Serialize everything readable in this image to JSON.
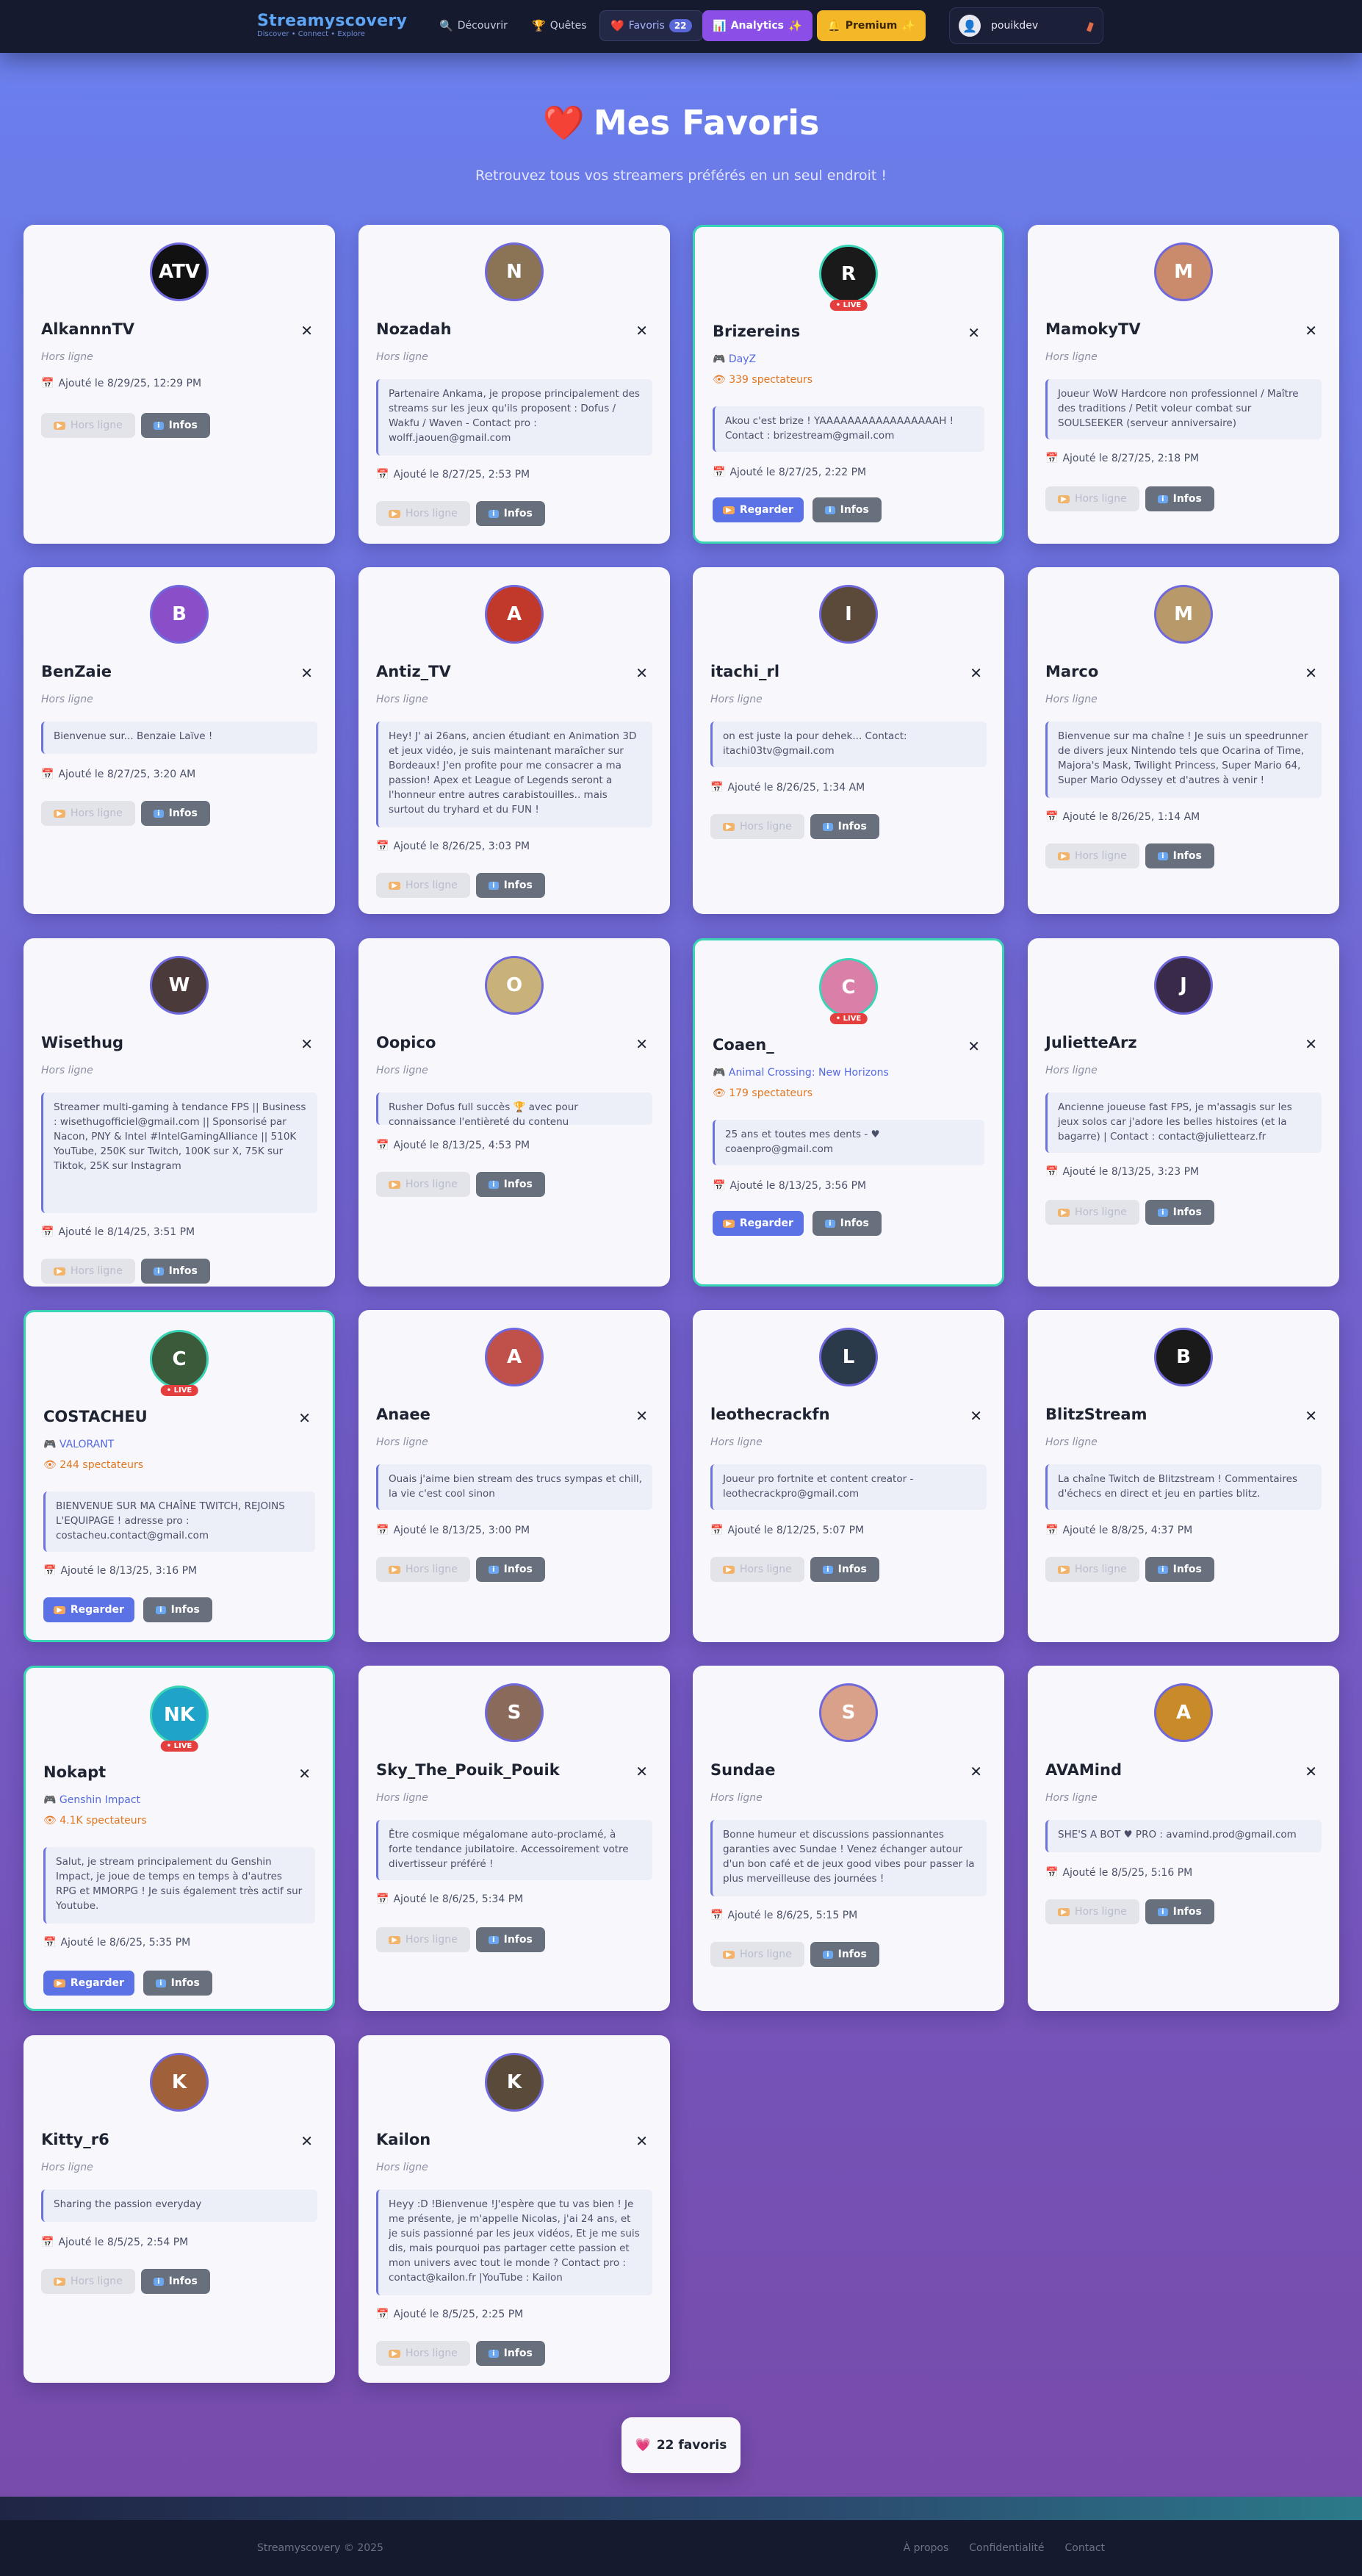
{
  "nav": {
    "brand": "Streamyscovery",
    "tagline": "Discover • Connect • Explore",
    "discover": "Découvrir",
    "discover_icon": "search-icon",
    "quests": "Quêtes",
    "quests_icon": "trophy-icon",
    "favorites": "Favoris",
    "favorites_count": "22",
    "analytics": "Analytics",
    "premium": "Premium",
    "user": "pouikdev"
  },
  "hero": {
    "title": "Mes Favoris",
    "subtitle": "Retrouvez tous vos streamers préférés en un seul endroit !"
  },
  "labels": {
    "offline": "Hors ligne",
    "offline_btn": "Hors ligne",
    "watch_btn": "Regarder",
    "info_btn": "Infos",
    "live": "• LIVE"
  },
  "streamers": [
    {
      "name": "AlkannnTV",
      "live": false,
      "bio": "",
      "date": "Ajouté le 8/29/25, 12:29 PM",
      "avatar_text": "ATV",
      "avatar_color": "#111111"
    },
    {
      "name": "Nozadah",
      "live": false,
      "bio": "Partenaire Ankama, je propose principalement des streams sur les jeux qu'ils proposent : Dofus / Wakfu / Waven - Contact pro : wolff.jaouen@gmail.com",
      "date": "Ajouté le 8/27/25, 2:53 PM",
      "avatar_text": "N",
      "avatar_color": "#8b7355"
    },
    {
      "name": "Brizereins",
      "live": true,
      "game": "DayZ",
      "viewers": "339 spectateurs",
      "bio": "Akou c'est brize ! YAAAAAAAAAAAAAAAAAH ! Contact : brizestream@gmail.com",
      "date": "Ajouté le 8/27/25, 2:22 PM",
      "avatar_text": "R",
      "avatar_color": "#1a1a1a"
    },
    {
      "name": "MamokyTV",
      "live": false,
      "bio": "Joueur WoW Hardcore non professionnel / Maître des traditions / Petit voleur combat sur SOULSEEKER (serveur anniversaire)",
      "date": "Ajouté le 8/27/25, 2:18 PM",
      "avatar_text": "M",
      "avatar_color": "#c98b6b"
    },
    {
      "name": "BenZaie",
      "live": false,
      "bio": "Bienvenue sur... Benzaie Laïve !",
      "date": "Ajouté le 8/27/25, 3:20 AM",
      "avatar_text": "B",
      "avatar_color": "#8a4fc8"
    },
    {
      "name": "Antiz_TV",
      "live": false,
      "bio": "Hey! J' ai 26ans, ancien étudiant en Animation 3D et jeux vidéo, je suis maintenant maraîcher sur Bordeaux! J'en profite pour me consacrer a ma passion! Apex et League of Legends seront a l'honneur entre autres carabistouilles.. mais surtout du tryhard et du FUN !",
      "date": "Ajouté le 8/26/25, 3:03 PM",
      "avatar_text": "A",
      "avatar_color": "#c0392b"
    },
    {
      "name": "itachi_rl",
      "live": false,
      "bio": "on est juste la pour dehek... Contact: itachi03tv@gmail.com",
      "date": "Ajouté le 8/26/25, 1:34 AM",
      "avatar_text": "I",
      "avatar_color": "#5b4a3a"
    },
    {
      "name": "Marco",
      "live": false,
      "bio": "Bienvenue sur ma chaîne ! Je suis un speedrunner de divers jeux Nintendo tels que Ocarina of Time, Majora's Mask, Twilight Princess, Super Mario 64, Super Mario Odyssey et d'autres à venir !",
      "date": "Ajouté le 8/26/25, 1:14 AM",
      "avatar_text": "M",
      "avatar_color": "#b89a6a"
    },
    {
      "name": "Wisethug",
      "live": false,
      "bio": "Streamer multi-gaming à tendance FPS || Business : wisethugofficiel@gmail.com || Sponsorisé par Nacon, PNY & Intel #IntelGamingAlliance || 510K YouTube, 250K sur Twitch, 100K sur X, 75K sur Tiktok, 25K sur Instagram",
      "date": "Ajouté le 8/14/25, 3:51 PM",
      "avatar_text": "W",
      "avatar_color": "#4a3a3a"
    },
    {
      "name": "Oopico",
      "live": false,
      "bio": "Rusher Dofus full succès 🏆 avec pour connaissance l'entièreté du contenu",
      "date": "Ajouté le 8/13/25, 4:53 PM",
      "avatar_text": "O",
      "avatar_color": "#c9b27a"
    },
    {
      "name": "Coaen_",
      "live": true,
      "game": "Animal Crossing: New Horizons",
      "viewers": "179 spectateurs",
      "bio": "25 ans et toutes mes dents - ♥ coaenpro@gmail.com",
      "date": "Ajouté le 8/13/25, 3:56 PM",
      "avatar_text": "C",
      "avatar_color": "#d97fa8"
    },
    {
      "name": "JulietteArz",
      "live": false,
      "bio": "Ancienne joueuse fast FPS, je m'assagis sur les jeux solos car j'adore les belles histoires (et la bagarre) | Contact : contact@juliettearz.fr",
      "date": "Ajouté le 8/13/25, 3:23 PM",
      "avatar_text": "J",
      "avatar_color": "#3a2a4a"
    },
    {
      "name": "COSTACHEU",
      "live": true,
      "game": "VALORANT",
      "viewers": "244 spectateurs",
      "bio": "BIENVENUE SUR MA CHAÎNE TWITCH, REJOINS L'EQUIPAGE ! adresse pro : costacheu.contact@gmail.com",
      "date": "Ajouté le 8/13/25, 3:16 PM",
      "avatar_text": "C",
      "avatar_color": "#3a5a3a"
    },
    {
      "name": "Anaee",
      "live": false,
      "bio": "Ouais j'aime bien stream des trucs sympas et chill, la vie c'est cool sinon",
      "date": "Ajouté le 8/13/25, 3:00 PM",
      "avatar_text": "A",
      "avatar_color": "#c0504a"
    },
    {
      "name": "leothecrackfn",
      "live": false,
      "bio": "Joueur pro fortnite et content creator - leothecrackpro@gmail.com",
      "date": "Ajouté le 8/12/25, 5:07 PM",
      "avatar_text": "L",
      "avatar_color": "#2a3a4a"
    },
    {
      "name": "BlitzStream",
      "live": false,
      "bio": "La chaîne Twitch de Blitzstream ! Commentaires d'échecs en direct et jeu en parties blitz.",
      "date": "Ajouté le 8/8/25, 4:37 PM",
      "avatar_text": "B",
      "avatar_color": "#1a1a1a"
    },
    {
      "name": "Nokapt",
      "live": true,
      "game": "Genshin Impact",
      "viewers": "4.1K spectateurs",
      "bio": "Salut, je stream principalement du Genshin Impact, je joue de temps en temps à d'autres RPG et MMORPG ! Je suis également très actif sur Youtube.",
      "date": "Ajouté le 8/6/25, 5:35 PM",
      "avatar_text": "NK",
      "avatar_color": "#1fa3c9"
    },
    {
      "name": "Sky_The_Pouik_Pouik",
      "live": false,
      "bio": "Être cosmique mégalomane auto-proclamé, à forte tendance jubilatoire. Accessoirement votre divertisseur préféré !",
      "date": "Ajouté le 8/6/25, 5:34 PM",
      "avatar_text": "S",
      "avatar_color": "#8a6a5a"
    },
    {
      "name": "Sundae",
      "live": false,
      "bio": "Bonne humeur et discussions passionnantes garanties avec Sundae ! Venez échanger autour d'un bon café et de jeux good vibes pour passer la plus merveilleuse des journées !",
      "date": "Ajouté le 8/6/25, 5:15 PM",
      "avatar_text": "S",
      "avatar_color": "#d9a08a"
    },
    {
      "name": "AVAMind",
      "live": false,
      "bio": "SHE'S A BOT ♥ PRO : avamind.prod@gmail.com",
      "date": "Ajouté le 8/5/25, 5:16 PM",
      "avatar_text": "A",
      "avatar_color": "#c98a2a"
    },
    {
      "name": "Kitty_r6",
      "live": false,
      "bio": "Sharing the passion everyday",
      "date": "Ajouté le 8/5/25, 2:54 PM",
      "avatar_text": "K",
      "avatar_color": "#a0603a"
    },
    {
      "name": "Kailon",
      "live": false,
      "bio": "Heyy :D !Bienvenue !J'espère que tu vas bien ! Je me présente, je m'appelle Nicolas, j'ai 24 ans, et je suis passionné par les jeux vidéos, Et je me suis dis, mais pourquoi pas partager cette passion et mon univers avec tout le monde ? Contact pro : contact@kailon.fr |YouTube : Kailon",
      "date": "Ajouté le 8/5/25, 2:25 PM",
      "avatar_text": "K",
      "avatar_color": "#5a4a3a"
    }
  ],
  "counter": "22 favoris",
  "footer": {
    "copyright": "Streamyscovery © 2025",
    "links": [
      "À propos",
      "Confidentialité",
      "Contact"
    ]
  }
}
